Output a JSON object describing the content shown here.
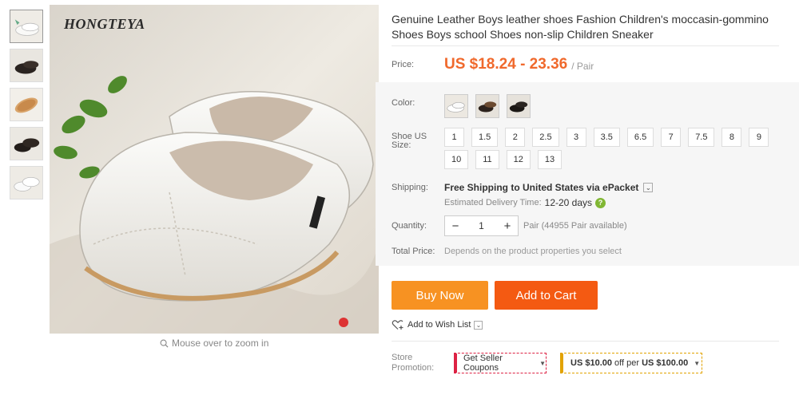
{
  "gallery": {
    "brand_overlay": "HONGTEYA",
    "zoom_hint": "Mouse over to zoom in",
    "thumbnails": [
      "white-shoe",
      "black-shoe",
      "shoe-sole",
      "black-pair",
      "white-pair"
    ]
  },
  "product": {
    "title": "Genuine Leather Boys leather shoes Fashion Children's moccasin-gommino Shoes Boys school Shoes non-slip Children Sneaker"
  },
  "price": {
    "label": "Price:",
    "value": "US $18.24 - 23.36",
    "unit": "/ Pair"
  },
  "color": {
    "label": "Color:",
    "options": [
      "white",
      "black-brown",
      "black"
    ]
  },
  "size": {
    "label_line1": "Shoe US",
    "label_line2": "Size:",
    "options": [
      "1",
      "1.5",
      "2",
      "2.5",
      "3",
      "3.5",
      "6.5",
      "7",
      "7.5",
      "8",
      "9",
      "10",
      "11",
      "12",
      "13"
    ]
  },
  "shipping": {
    "label": "Shipping:",
    "main": "Free Shipping to United States via ePacket",
    "delivery_label": "Estimated Delivery Time:",
    "delivery_days": "12-20 days"
  },
  "quantity": {
    "label": "Quantity:",
    "value": "1",
    "minus": "−",
    "plus": "+",
    "available": "Pair (44955 Pair available)"
  },
  "total": {
    "label": "Total Price:",
    "value": "Depends on the product properties you select"
  },
  "actions": {
    "buy_now": "Buy Now",
    "add_to_cart": "Add to Cart",
    "wish_list": "Add to Wish List"
  },
  "promotion": {
    "label_line1": "Store",
    "label_line2": "Promotion:",
    "seller_coupons": "Get Seller Coupons",
    "discount_prefix": "US $10.00",
    "discount_mid": " off per ",
    "discount_suffix": "US $100.00"
  },
  "colors": {
    "price_orange": "#f0692c",
    "buy_now": "#f79222",
    "add_to_cart": "#f45a12",
    "help_green": "#81b734"
  }
}
